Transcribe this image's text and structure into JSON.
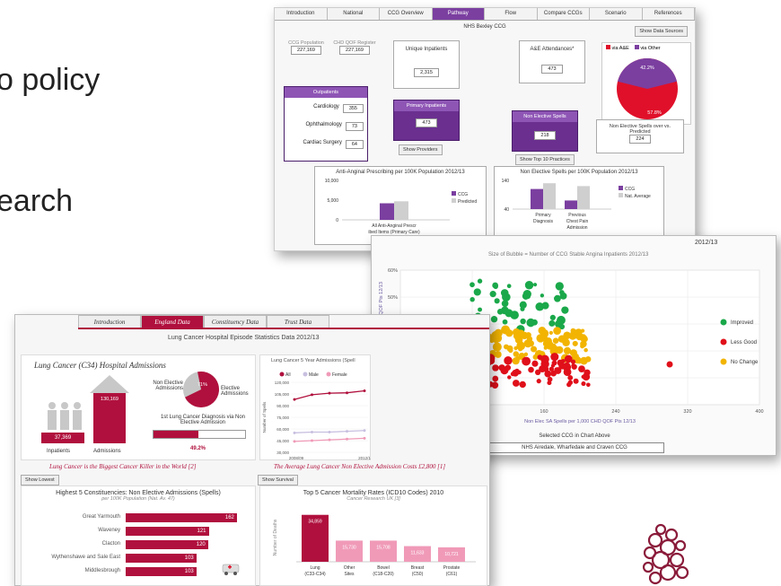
{
  "background_text": {
    "line1": "o policy",
    "line2": "earch"
  },
  "pathway": {
    "tabs": [
      "Introduction",
      "National",
      "CCG Overview",
      "Pathway",
      "Flow",
      "Compare CCGs",
      "Scenario",
      "References"
    ],
    "active_tab": "Pathway",
    "title": "NHS Bexley CCG",
    "show_data_sources": "Show Data Sources",
    "ccg_population_label": "CCG Population",
    "ccg_population_value": "227,169",
    "chd_qof_label": "CHD QOF Register",
    "chd_qof_value": "227,169",
    "unique_inpatients_label": "Unique Inpatients",
    "unique_inpatients_value": "2,315",
    "ae_label": "A&E Attendances*",
    "ae_value": "473",
    "outpatients_label": "Outpatients",
    "outpatients": [
      {
        "label": "Cardiology",
        "value": "355"
      },
      {
        "label": "Ophthalmology",
        "value": "73"
      },
      {
        "label": "Cardiac Surgery",
        "value": "64"
      }
    ],
    "primary_inpatients_label": "Primary Inpatients",
    "primary_inpatients_value": "473",
    "show_providers": "Show Providers",
    "non_elective_label": "Non Elective Spells",
    "non_elective_value": "218",
    "show_top10": "Show Top 10 Practices",
    "ne_over_pred_label": "Non Elective Spells over vs. Predicted",
    "ne_over_pred_value": "224",
    "pie": {
      "legend_ae": "via A&E",
      "legend_other": "via Other",
      "pct_other": "42.2%",
      "pct_ae": "57.8%",
      "color_ae": "#e0102a",
      "color_other": "#7b3fa0"
    },
    "chart1": {
      "title": "Anti-Anginal Prescribing per 100K Population 2012/13",
      "yticks": [
        "10,000",
        "5,000",
        "0"
      ],
      "xlabel": "All Anti-Anginal Prescribed Items (Primary Care)",
      "legend": [
        "CCG",
        "Predicted"
      ],
      "values": [
        4200,
        4700
      ],
      "ymax": 10000
    },
    "chart2": {
      "title": "Non Elective Spells per 100K Population 2012/13",
      "yticks": [
        "140",
        "40"
      ],
      "categories": [
        "Primary Diagnosis",
        "Previous Chest Pain Admission"
      ],
      "legend": [
        "CCG",
        "Nat. Average"
      ],
      "ccg": [
        110,
        70
      ],
      "avg": [
        130,
        120
      ],
      "ymin": 40,
      "ymax": 140
    }
  },
  "scatter": {
    "header": "2012/13",
    "subtitle": "Size of Bubble = Number of CCG Stable Angina Inpatients 2012/13",
    "ylabel": "Non Elec SA Spells per 1,000 CHD QOF Pts 12/13",
    "xlabel": "Non Elec SA Spells per 1,000 CHD QOF Pts 12/13",
    "xticks": [
      "0",
      "80",
      "160",
      "240",
      "320",
      "400"
    ],
    "yticks": [
      "60%",
      "50%",
      "40%",
      "30%",
      "20%",
      "10%"
    ],
    "legend": [
      {
        "label": "Improved",
        "color": "#1aa84a"
      },
      {
        "label": "Less Good",
        "color": "#e0101a"
      },
      {
        "label": "No Change",
        "color": "#f2b400"
      }
    ],
    "selected_label": "Selected CCG in Chart Above",
    "selected_value": "NHS Airedale, Wharfedale and Craven CCG"
  },
  "lung": {
    "tabs": [
      "Introduction",
      "England Data",
      "Constituency Data",
      "Trust Data"
    ],
    "active_tab": "England Data",
    "title": "Lung Cancer Hospital Episode Statistics Data 2012/13",
    "admissions_title": "Lung Cancer (C34) Hospital Admissions",
    "inpatients_value": "37,369",
    "inpatients_label": "Inpatients",
    "admissions_value": "130,169",
    "admissions_label": "Admissions",
    "non_elective_label": "Non Elective Admissions",
    "elective_label": "Elective Admissions",
    "pie_pct": "71%",
    "first_diag_label": "1st Lung Cancer Diagnosis via Non Elective Admission",
    "first_diag_pct": "49.2%",
    "line_title": "Lung Cancer 5 Year Admissions (Spell",
    "line_legend": [
      "All",
      "Male",
      "Female"
    ],
    "line_yticks": [
      "120,000",
      "105,000",
      "90,000",
      "75,000",
      "60,000",
      "45,000",
      "30,000"
    ],
    "line_xticks": [
      "2008/09",
      "2012/1"
    ],
    "line_ylabel": "Number of Spells",
    "killer_text": "Lung Cancer is the Biggest Cancer Killer in the World [2]",
    "cost_text": "The Average Lung Cancer Non Elective Admission Costs £2,800 [1]",
    "show_lowest": "Show Lowest",
    "show_survival": "Show Survival",
    "constituency_title": "Highest 5 Constituencies: Non Elective Admissions (Spells)",
    "constituency_sub": "per 100K Population (Nat. Av. 47)",
    "constituencies": [
      {
        "label": "Great Yarmouth",
        "value": "162"
      },
      {
        "label": "Waveney",
        "value": "121"
      },
      {
        "label": "Clacton",
        "value": "120"
      },
      {
        "label": "Wythenshawe and Sale East",
        "value": "103"
      },
      {
        "label": "Middlesbrough",
        "value": "103"
      }
    ],
    "mortality_title": "Top 5 Cancer Mortality Rates (ICD10 Codes) 2010",
    "mortality_sub": "Cancer Research UK [3]",
    "mortality_ylabel": "Number of Deaths",
    "mortality": [
      {
        "label": "Lung (C33-C34)",
        "value": "34,859",
        "num": 34859
      },
      {
        "label": "Other Sites",
        "value": "15,730",
        "num": 15730
      },
      {
        "label": "Bowel (C18-C20)",
        "value": "15,708",
        "num": 15708
      },
      {
        "label": "Breast (C50)",
        "value": "11,633",
        "num": 11633
      },
      {
        "label": "Prostate (C61)",
        "value": "10,721",
        "num": 10721
      }
    ]
  },
  "chart_data": [
    {
      "type": "pie",
      "title": "",
      "labels": [
        "via A&E",
        "via Other"
      ],
      "values": [
        57.8,
        42.2
      ]
    },
    {
      "type": "bar",
      "title": "Anti-Anginal Prescribing per 100K Population 2012/13",
      "categories": [
        "All Anti-Anginal Prescribed Items (Primary Care)"
      ],
      "series": [
        {
          "name": "CCG",
          "values": [
            4200
          ]
        },
        {
          "name": "Predicted",
          "values": [
            4700
          ]
        }
      ],
      "ylim": [
        0,
        10000
      ]
    },
    {
      "type": "bar",
      "title": "Non Elective Spells per 100K Population 2012/13",
      "categories": [
        "Primary Diagnosis",
        "Previous Chest Pain Admission"
      ],
      "series": [
        {
          "name": "CCG",
          "values": [
            110,
            70
          ]
        },
        {
          "name": "Nat. Average",
          "values": [
            130,
            120
          ]
        }
      ],
      "ylim": [
        40,
        140
      ]
    },
    {
      "type": "bar",
      "title": "Highest 5 Constituencies: Non Elective Admissions (Spells)",
      "categories": [
        "Great Yarmouth",
        "Waveney",
        "Clacton",
        "Wythenshawe and Sale East",
        "Middlesbrough"
      ],
      "values": [
        162,
        121,
        120,
        103,
        103
      ]
    },
    {
      "type": "bar",
      "title": "Top 5 Cancer Mortality Rates (ICD10 Codes) 2010",
      "categories": [
        "Lung (C33-C34)",
        "Other Sites",
        "Bowel (C18-C20)",
        "Breast (C50)",
        "Prostate (C61)"
      ],
      "values": [
        34859,
        15730,
        15708,
        11633,
        10721
      ]
    }
  ]
}
